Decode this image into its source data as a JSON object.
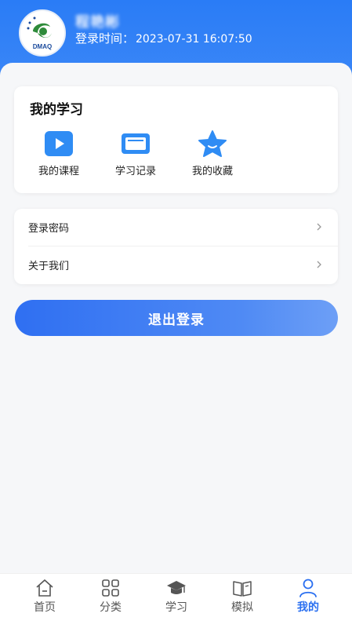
{
  "header": {
    "username": "程艳彬",
    "login_time_label": "登录时间：",
    "login_time_value": "2023-07-31 16:07:50",
    "logo_text": "DMAQ"
  },
  "study": {
    "title": "我的学习",
    "items": [
      {
        "label": "我的课程",
        "icon": "play-icon"
      },
      {
        "label": "学习记录",
        "icon": "card-icon"
      },
      {
        "label": "我的收藏",
        "icon": "star-icon"
      }
    ]
  },
  "menu": {
    "items": [
      {
        "label": "登录密码"
      },
      {
        "label": "关于我们"
      }
    ]
  },
  "logout": {
    "label": "退出登录"
  },
  "tabbar": {
    "items": [
      {
        "label": "首页",
        "icon": "home-icon"
      },
      {
        "label": "分类",
        "icon": "grid-icon"
      },
      {
        "label": "学习",
        "icon": "graduation-cap-icon"
      },
      {
        "label": "模拟",
        "icon": "book-icon"
      },
      {
        "label": "我的",
        "icon": "user-icon",
        "active": true
      }
    ]
  },
  "colors": {
    "primary": "#2a7cf6",
    "active_tab": "#2a6ff0",
    "icon_blue": "#2f8cf4"
  }
}
